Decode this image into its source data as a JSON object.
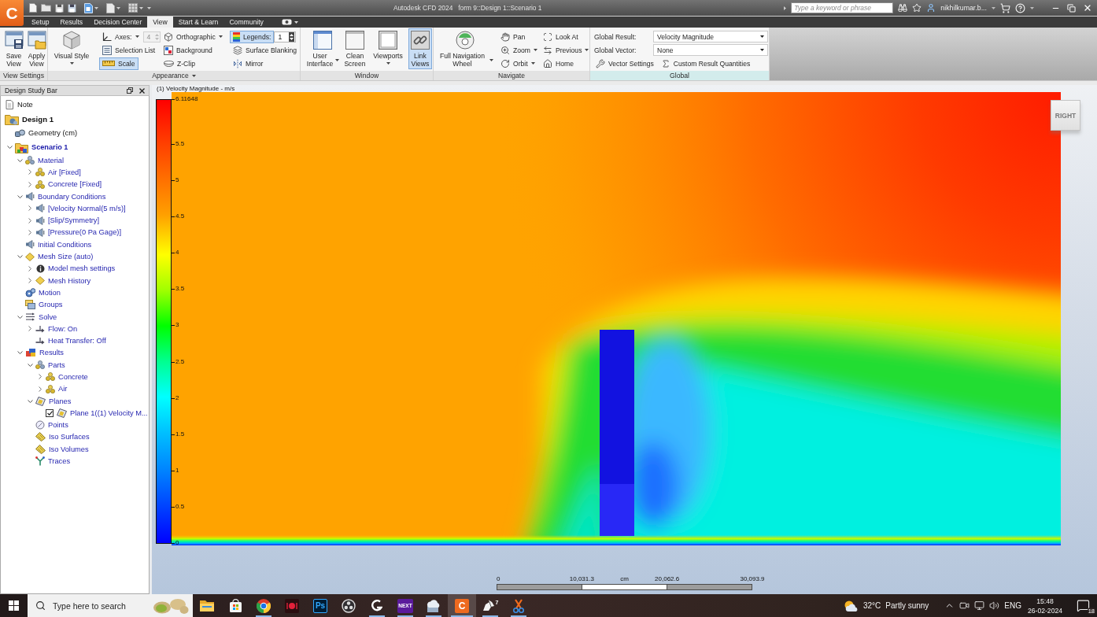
{
  "title_bar": {
    "app_button": "C",
    "app_title": "Autodesk CFD 2024",
    "document_title": "form 9::Design 1::Scenario 1",
    "search": {
      "placeholder": "Type a keyword or phrase"
    },
    "user": "nikhilkumar.b..."
  },
  "tabs": [
    {
      "label": "Setup",
      "selected": false
    },
    {
      "label": "Results",
      "selected": false
    },
    {
      "label": "Decision Center",
      "selected": false
    },
    {
      "label": "View",
      "selected": true
    },
    {
      "label": "Start & Learn",
      "selected": false
    },
    {
      "label": "Community",
      "selected": false
    }
  ],
  "ribbon": {
    "view_settings": {
      "title": "View Settings",
      "buttons": [
        {
          "kind": "save",
          "label": "Save View"
        },
        {
          "kind": "apply",
          "label": "Apply View"
        }
      ]
    },
    "appearance": {
      "title": "Appearance",
      "visual_style": "Visual Style",
      "axes": {
        "label": "Axes:",
        "value": "4",
        "disabled": true
      },
      "selection_list": "Selection List",
      "scale": {
        "label": "Scale",
        "selected": true
      },
      "orthographic": "Orthographic",
      "background": "Background",
      "z_clip": "Z-Clip",
      "legends": {
        "label": "Legends:",
        "selected": true,
        "value": "1"
      },
      "surface_blanking": "Surface Blanking",
      "mirror": "Mirror"
    },
    "window": {
      "title": "Window",
      "buttons": [
        {
          "kind": "user_interface",
          "label": "User Interface",
          "dropdown": true,
          "selected": false
        },
        {
          "kind": "clean_screen",
          "label": "Clean Screen",
          "dropdown": false,
          "selected": false
        },
        {
          "kind": "viewports",
          "label": "Viewports",
          "dropdown": true,
          "selected": false
        },
        {
          "kind": "link_views",
          "label": "Link Views",
          "dropdown": false,
          "selected": true
        }
      ]
    },
    "navigate": {
      "title": "Navigate",
      "wheel": {
        "label": "Full Navigation Wheel",
        "dropdown": true
      },
      "tools": [
        {
          "kind": "pan",
          "label": "Pan",
          "dropdown": false
        },
        {
          "kind": "zoom",
          "label": "Zoom",
          "dropdown": true
        },
        {
          "kind": "orbit",
          "label": "Orbit",
          "dropdown": true
        },
        {
          "kind": "look_at",
          "label": "Look At",
          "dropdown": false
        },
        {
          "kind": "previous",
          "label": "Previous",
          "dropdown": true
        },
        {
          "kind": "home",
          "label": "Home",
          "dropdown": false
        }
      ]
    },
    "global": {
      "title": "Global",
      "result": {
        "label": "Global Result:",
        "value": "Velocity Magnitude"
      },
      "vector": {
        "label": "Global Vector:",
        "value": "None"
      },
      "buttons": [
        {
          "kind": "vector_settings",
          "label": "Vector Settings"
        },
        {
          "kind": "custom_quantities",
          "label": "Custom Result Quantities"
        }
      ]
    }
  },
  "design_study_bar": {
    "title": "Design Study Bar",
    "tree": [
      {
        "label": "Note",
        "kind": "note"
      },
      {
        "label": "Design 1",
        "kind": "design",
        "children": [
          {
            "label": "Geometry (cm)",
            "kind": "geometry"
          },
          {
            "label": "Scenario 1",
            "kind": "scenario",
            "expanded": true,
            "children": [
              {
                "label": "Material",
                "kind": "material",
                "expanded": true,
                "children": [
                  {
                    "label": "Air [Fixed]",
                    "kind": "part",
                    "expanded": false
                  },
                  {
                    "label": "Concrete [Fixed]",
                    "kind": "part",
                    "expanded": false
                  }
                ]
              },
              {
                "label": "Boundary Conditions",
                "kind": "boundary",
                "expanded": true,
                "children": [
                  {
                    "label": "[Velocity Normal(5 m/s)]",
                    "kind": "boundary",
                    "expanded": false
                  },
                  {
                    "label": "[Slip/Symmetry]",
                    "kind": "boundary",
                    "expanded": false
                  },
                  {
                    "label": "[Pressure(0 Pa Gage)]",
                    "kind": "boundary",
                    "expanded": false
                  }
                ]
              },
              {
                "label": "Initial Conditions",
                "kind": "boundary"
              },
              {
                "label": "Mesh Size (auto)",
                "kind": "mesh",
                "expanded": true,
                "children": [
                  {
                    "label": "Model mesh settings",
                    "kind": "settings",
                    "expanded": false
                  },
                  {
                    "label": "Mesh History",
                    "kind": "mesh",
                    "expanded": false
                  }
                ]
              },
              {
                "label": "Motion",
                "kind": "motion"
              },
              {
                "label": "Groups",
                "kind": "groups"
              },
              {
                "label": "Solve",
                "kind": "solve",
                "expanded": true,
                "children": [
                  {
                    "label": "Flow: On",
                    "kind": "flow",
                    "expanded": false
                  },
                  {
                    "label": "Heat Transfer: Off",
                    "kind": "flow"
                  }
                ]
              },
              {
                "label": "Results",
                "kind": "results",
                "expanded": true,
                "children": [
                  {
                    "label": "Parts",
                    "kind": "material",
                    "expanded": true,
                    "children": [
                      {
                        "label": "Concrete",
                        "kind": "part",
                        "expanded": false
                      },
                      {
                        "label": "Air",
                        "kind": "part",
                        "expanded": false
                      }
                    ]
                  },
                  {
                    "label": "Planes",
                    "kind": "plane",
                    "expanded": true,
                    "children": [
                      {
                        "label": "Plane 1((1) Velocity M...",
                        "kind": "plane",
                        "checked": true
                      }
                    ]
                  },
                  {
                    "label": "Points",
                    "kind": "point"
                  },
                  {
                    "label": "Iso Surfaces",
                    "kind": "iso"
                  },
                  {
                    "label": "Iso Volumes",
                    "kind": "iso"
                  },
                  {
                    "label": "Traces",
                    "kind": "trace"
                  }
                ]
              }
            ]
          }
        ]
      }
    ]
  },
  "viewport": {
    "title": "(1) Velocity Magnitude - m/s",
    "legend": {
      "max": "6.11648",
      "ticks": [
        "5.5",
        "5",
        "4.5",
        "4",
        "3.5",
        "3",
        "2.5",
        "2",
        "1.5",
        "1",
        "0.5",
        "0"
      ]
    },
    "view_cube": "RIGHT",
    "scale_bar": {
      "labels": [
        "0",
        "10,031.3",
        "20,062.6",
        "30,093.9"
      ],
      "unit": "cm"
    }
  },
  "taskbar": {
    "search": {
      "placeholder": "Type here to search"
    },
    "apps": [
      {
        "kind": "explorer",
        "running": false,
        "selected": false
      },
      {
        "kind": "store",
        "running": false,
        "selected": false
      },
      {
        "kind": "browser",
        "running": true,
        "selected": false
      },
      {
        "kind": "red_app",
        "running": false,
        "selected": false
      },
      {
        "kind": "tile",
        "text": "Ps",
        "running": false,
        "selected": false
      },
      {
        "kind": "recorder",
        "running": false,
        "selected": false
      },
      {
        "kind": "hook",
        "running": true,
        "selected": false
      },
      {
        "kind": "purple_tile",
        "text": "NEXT",
        "running": true,
        "selected": false
      },
      {
        "kind": "cloud",
        "running": true,
        "selected": false
      },
      {
        "kind": "orange_tile",
        "text": "C",
        "running": true,
        "selected": true
      },
      {
        "kind": "horn",
        "text": "7",
        "running": true,
        "selected": false
      },
      {
        "kind": "scissors",
        "running": true,
        "selected": false
      }
    ],
    "weather": {
      "temperature": "32°C",
      "condition": "Partly sunny"
    },
    "language": "ENG",
    "time": "15:48",
    "date": "26-02-2024",
    "notifications": "18"
  }
}
